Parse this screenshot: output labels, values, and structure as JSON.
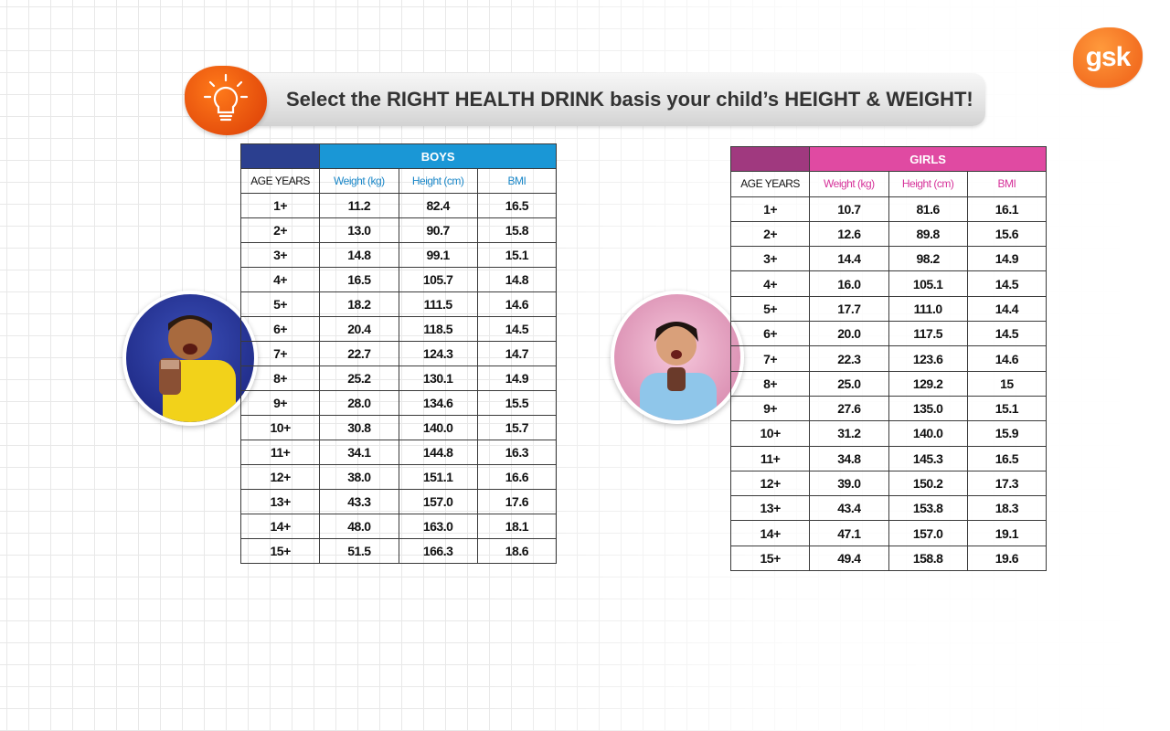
{
  "brand": {
    "logo_text": "gsk",
    "accent": "#f36f21"
  },
  "banner": {
    "headline": "Select the RIGHT HEALTH DRINK basis your child’s HEIGHT & WEIGHT!",
    "icon": "lightbulb-icon"
  },
  "boys": {
    "group_label": "BOYS",
    "header_color": "#1a97d6",
    "columns": [
      "AGE YEARS",
      "Weight (kg)",
      "Height (cm)",
      "BMI"
    ],
    "rows": [
      [
        "1+",
        "11.2",
        "82.4",
        "16.5"
      ],
      [
        "2+",
        "13.0",
        "90.7",
        "15.8"
      ],
      [
        "3+",
        "14.8",
        "99.1",
        "15.1"
      ],
      [
        "4+",
        "16.5",
        "105.7",
        "14.8"
      ],
      [
        "5+",
        "18.2",
        "111.5",
        "14.6"
      ],
      [
        "6+",
        "20.4",
        "118.5",
        "14.5"
      ],
      [
        "7+",
        "22.7",
        "124.3",
        "14.7"
      ],
      [
        "8+",
        "25.2",
        "130.1",
        "14.9"
      ],
      [
        "9+",
        "28.0",
        "134.6",
        "15.5"
      ],
      [
        "10+",
        "30.8",
        "140.0",
        "15.7"
      ],
      [
        "11+",
        "34.1",
        "144.8",
        "16.3"
      ],
      [
        "12+",
        "38.0",
        "151.1",
        "16.6"
      ],
      [
        "13+",
        "43.3",
        "157.0",
        "17.6"
      ],
      [
        "14+",
        "48.0",
        "163.0",
        "18.1"
      ],
      [
        "15+",
        "51.5",
        "166.3",
        "18.6"
      ]
    ]
  },
  "girls": {
    "group_label": "GIRLS",
    "header_color": "#e04aa2",
    "columns": [
      "AGE YEARS",
      "Weight (kg)",
      "Height (cm)",
      "BMI"
    ],
    "rows": [
      [
        "1+",
        "10.7",
        "81.6",
        "16.1"
      ],
      [
        "2+",
        "12.6",
        "89.8",
        "15.6"
      ],
      [
        "3+",
        "14.4",
        "98.2",
        "14.9"
      ],
      [
        "4+",
        "16.0",
        "105.1",
        "14.5"
      ],
      [
        "5+",
        "17.7",
        "111.0",
        "14.4"
      ],
      [
        "6+",
        "20.0",
        "117.5",
        "14.5"
      ],
      [
        "7+",
        "22.3",
        "123.6",
        "14.6"
      ],
      [
        "8+",
        "25.0",
        "129.2",
        "15"
      ],
      [
        "9+",
        "27.6",
        "135.0",
        "15.1"
      ],
      [
        "10+",
        "31.2",
        "140.0",
        "15.9"
      ],
      [
        "11+",
        "34.8",
        "145.3",
        "16.5"
      ],
      [
        "12+",
        "39.0",
        "150.2",
        "17.3"
      ],
      [
        "13+",
        "43.4",
        "153.8",
        "18.3"
      ],
      [
        "14+",
        "47.1",
        "157.0",
        "19.1"
      ],
      [
        "15+",
        "49.4",
        "158.8",
        "19.6"
      ]
    ]
  }
}
